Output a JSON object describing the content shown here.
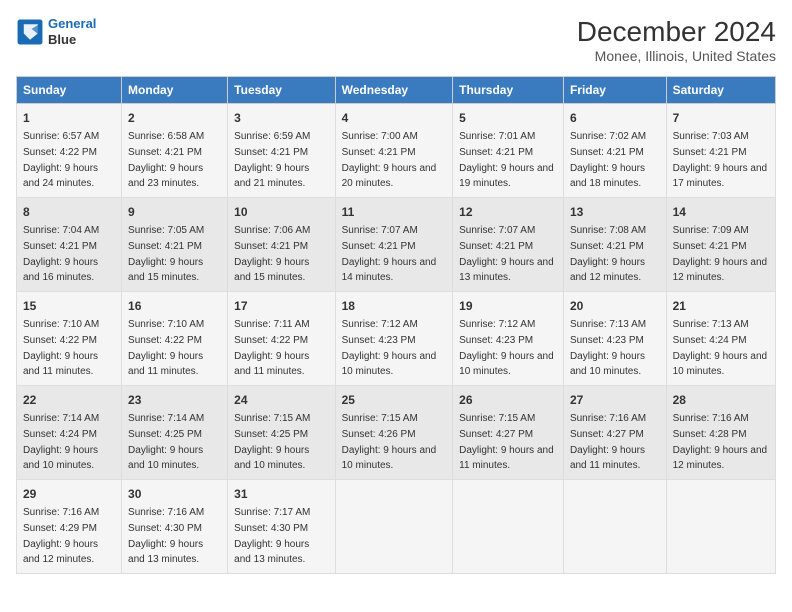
{
  "header": {
    "logo_line1": "General",
    "logo_line2": "Blue",
    "title": "December 2024",
    "subtitle": "Monee, Illinois, United States"
  },
  "columns": [
    "Sunday",
    "Monday",
    "Tuesday",
    "Wednesday",
    "Thursday",
    "Friday",
    "Saturday"
  ],
  "rows": [
    [
      {
        "day": "1",
        "sunrise": "6:57 AM",
        "sunset": "4:22 PM",
        "daylight": "9 hours and 24 minutes."
      },
      {
        "day": "2",
        "sunrise": "6:58 AM",
        "sunset": "4:21 PM",
        "daylight": "9 hours and 23 minutes."
      },
      {
        "day": "3",
        "sunrise": "6:59 AM",
        "sunset": "4:21 PM",
        "daylight": "9 hours and 21 minutes."
      },
      {
        "day": "4",
        "sunrise": "7:00 AM",
        "sunset": "4:21 PM",
        "daylight": "9 hours and 20 minutes."
      },
      {
        "day": "5",
        "sunrise": "7:01 AM",
        "sunset": "4:21 PM",
        "daylight": "9 hours and 19 minutes."
      },
      {
        "day": "6",
        "sunrise": "7:02 AM",
        "sunset": "4:21 PM",
        "daylight": "9 hours and 18 minutes."
      },
      {
        "day": "7",
        "sunrise": "7:03 AM",
        "sunset": "4:21 PM",
        "daylight": "9 hours and 17 minutes."
      }
    ],
    [
      {
        "day": "8",
        "sunrise": "7:04 AM",
        "sunset": "4:21 PM",
        "daylight": "9 hours and 16 minutes."
      },
      {
        "day": "9",
        "sunrise": "7:05 AM",
        "sunset": "4:21 PM",
        "daylight": "9 hours and 15 minutes."
      },
      {
        "day": "10",
        "sunrise": "7:06 AM",
        "sunset": "4:21 PM",
        "daylight": "9 hours and 15 minutes."
      },
      {
        "day": "11",
        "sunrise": "7:07 AM",
        "sunset": "4:21 PM",
        "daylight": "9 hours and 14 minutes."
      },
      {
        "day": "12",
        "sunrise": "7:07 AM",
        "sunset": "4:21 PM",
        "daylight": "9 hours and 13 minutes."
      },
      {
        "day": "13",
        "sunrise": "7:08 AM",
        "sunset": "4:21 PM",
        "daylight": "9 hours and 12 minutes."
      },
      {
        "day": "14",
        "sunrise": "7:09 AM",
        "sunset": "4:21 PM",
        "daylight": "9 hours and 12 minutes."
      }
    ],
    [
      {
        "day": "15",
        "sunrise": "7:10 AM",
        "sunset": "4:22 PM",
        "daylight": "9 hours and 11 minutes."
      },
      {
        "day": "16",
        "sunrise": "7:10 AM",
        "sunset": "4:22 PM",
        "daylight": "9 hours and 11 minutes."
      },
      {
        "day": "17",
        "sunrise": "7:11 AM",
        "sunset": "4:22 PM",
        "daylight": "9 hours and 11 minutes."
      },
      {
        "day": "18",
        "sunrise": "7:12 AM",
        "sunset": "4:23 PM",
        "daylight": "9 hours and 10 minutes."
      },
      {
        "day": "19",
        "sunrise": "7:12 AM",
        "sunset": "4:23 PM",
        "daylight": "9 hours and 10 minutes."
      },
      {
        "day": "20",
        "sunrise": "7:13 AM",
        "sunset": "4:23 PM",
        "daylight": "9 hours and 10 minutes."
      },
      {
        "day": "21",
        "sunrise": "7:13 AM",
        "sunset": "4:24 PM",
        "daylight": "9 hours and 10 minutes."
      }
    ],
    [
      {
        "day": "22",
        "sunrise": "7:14 AM",
        "sunset": "4:24 PM",
        "daylight": "9 hours and 10 minutes."
      },
      {
        "day": "23",
        "sunrise": "7:14 AM",
        "sunset": "4:25 PM",
        "daylight": "9 hours and 10 minutes."
      },
      {
        "day": "24",
        "sunrise": "7:15 AM",
        "sunset": "4:25 PM",
        "daylight": "9 hours and 10 minutes."
      },
      {
        "day": "25",
        "sunrise": "7:15 AM",
        "sunset": "4:26 PM",
        "daylight": "9 hours and 10 minutes."
      },
      {
        "day": "26",
        "sunrise": "7:15 AM",
        "sunset": "4:27 PM",
        "daylight": "9 hours and 11 minutes."
      },
      {
        "day": "27",
        "sunrise": "7:16 AM",
        "sunset": "4:27 PM",
        "daylight": "9 hours and 11 minutes."
      },
      {
        "day": "28",
        "sunrise": "7:16 AM",
        "sunset": "4:28 PM",
        "daylight": "9 hours and 12 minutes."
      }
    ],
    [
      {
        "day": "29",
        "sunrise": "7:16 AM",
        "sunset": "4:29 PM",
        "daylight": "9 hours and 12 minutes."
      },
      {
        "day": "30",
        "sunrise": "7:16 AM",
        "sunset": "4:30 PM",
        "daylight": "9 hours and 13 minutes."
      },
      {
        "day": "31",
        "sunrise": "7:17 AM",
        "sunset": "4:30 PM",
        "daylight": "9 hours and 13 minutes."
      },
      {
        "day": "",
        "sunrise": "",
        "sunset": "",
        "daylight": ""
      },
      {
        "day": "",
        "sunrise": "",
        "sunset": "",
        "daylight": ""
      },
      {
        "day": "",
        "sunrise": "",
        "sunset": "",
        "daylight": ""
      },
      {
        "day": "",
        "sunrise": "",
        "sunset": "",
        "daylight": ""
      }
    ]
  ]
}
